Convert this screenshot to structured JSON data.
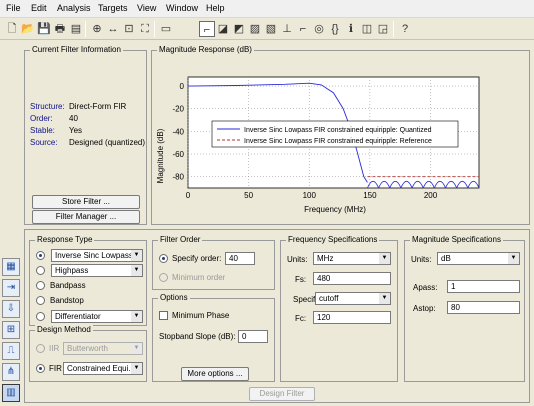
{
  "menu": [
    "File",
    "Edit",
    "Analysis",
    "Targets",
    "View",
    "Window",
    "Help"
  ],
  "toolbar_icons": [
    "new-file-icon",
    "open-icon",
    "save-icon",
    "print-icon",
    "print-preview-icon",
    "zoom-in-icon",
    "zoom-x-icon",
    "zoom-fit-icon",
    "full-view-icon",
    "filter-spec-icon",
    "magnitude-response-icon",
    "phase-response-icon",
    "magnitude-phase-icon",
    "group-delay-icon",
    "phase-delay-icon",
    "impulse-response-icon",
    "step-response-icon",
    "pole-zero-icon",
    "filter-coefficients-icon",
    "filter-info-icon",
    "magnitude-response-estimate-icon",
    "round-off-noise-icon",
    "whats-this-icon"
  ],
  "current_filter": {
    "title": "Current Filter Information",
    "rows": [
      {
        "label": "Structure:",
        "value": "Direct-Form FIR"
      },
      {
        "label": "Order:",
        "value": "40"
      },
      {
        "label": "Stable:",
        "value": "Yes"
      },
      {
        "label": "Source:",
        "value": "Designed (quantized)"
      }
    ],
    "store_button": "Store Filter ...",
    "manager_button": "Filter Manager ..."
  },
  "chart_data": {
    "type": "line",
    "title": "Magnitude Response (dB)",
    "xlabel": "Frequency (MHz)",
    "ylabel": "Magnitude (dB)",
    "xlim": [
      0,
      240
    ],
    "ylim": [
      -90,
      8
    ],
    "xticks": [
      0,
      50,
      100,
      150,
      200
    ],
    "yticks": [
      0,
      -20,
      -40,
      -60,
      -80
    ],
    "grid": true,
    "legend_position": "center",
    "series": [
      {
        "name": "Inverse Sinc Lowpass FIR constrained equiripple: Quantized",
        "color": "#2a2adc",
        "dash": "solid",
        "x": [
          0,
          40,
          80,
          100,
          110,
          120,
          128,
          135,
          140,
          145,
          148
        ],
        "y": [
          0,
          0.5,
          1.5,
          2.5,
          1,
          -6,
          -20,
          -40,
          -60,
          -80,
          -85
        ]
      },
      {
        "name": "Inverse Sinc Lowpass FIR constrained equiripple: Reference",
        "color": "#b03030",
        "dash": "dashed",
        "x": [
          148,
          240
        ],
        "y": [
          -80,
          -80
        ]
      }
    ],
    "stopband_lobes": {
      "start_x": 148,
      "end_x": 240,
      "count": 10,
      "floor": -90,
      "peak": -80
    }
  },
  "response_type": {
    "title": "Response Type",
    "options": [
      {
        "label": "Inverse Sinc Lowpass",
        "selected": true,
        "combo": true
      },
      {
        "label": "Highpass",
        "selected": false,
        "combo": true
      },
      {
        "label": "Bandpass",
        "selected": false,
        "combo": false
      },
      {
        "label": "Bandstop",
        "selected": false,
        "combo": false
      },
      {
        "label": "Differentiator",
        "selected": false,
        "combo": true
      }
    ]
  },
  "design_method": {
    "title": "Design Method",
    "iir_label": "IIR",
    "iir_value": "Butterworth",
    "fir_label": "FIR",
    "fir_value": "Constrained Equi..."
  },
  "filter_order": {
    "title": "Filter Order",
    "specify_label": "Specify order:",
    "specify_value": "40",
    "minimum_label": "Minimum order"
  },
  "options": {
    "title": "Options",
    "min_phase_label": "Minimum Phase",
    "stopband_label": "Stopband Slope (dB):",
    "stopband_value": "0",
    "more_button": "More options ..."
  },
  "freq_specs": {
    "title": "Frequency Specifications",
    "units_label": "Units:",
    "units_value": "MHz",
    "fs_label": "Fs:",
    "fs_value": "480",
    "specify_label": "Specif",
    "specify_value": "cutoff",
    "fc_label": "Fc:",
    "fc_value": "120"
  },
  "mag_specs": {
    "title": "Magnitude Specifications",
    "units_label": "Units:",
    "units_value": "dB",
    "apass_label": "Apass:",
    "apass_value": "1",
    "astop_label": "Astop:",
    "astop_value": "80"
  },
  "design_button": "Design Filter",
  "side_icons": [
    "design-filter-icon",
    "transform-icon",
    "import-icon",
    "quantize-icon",
    "realize-model-icon",
    "multirate-icon",
    "pole-zero-editor-icon",
    "filter-structure-icon"
  ]
}
